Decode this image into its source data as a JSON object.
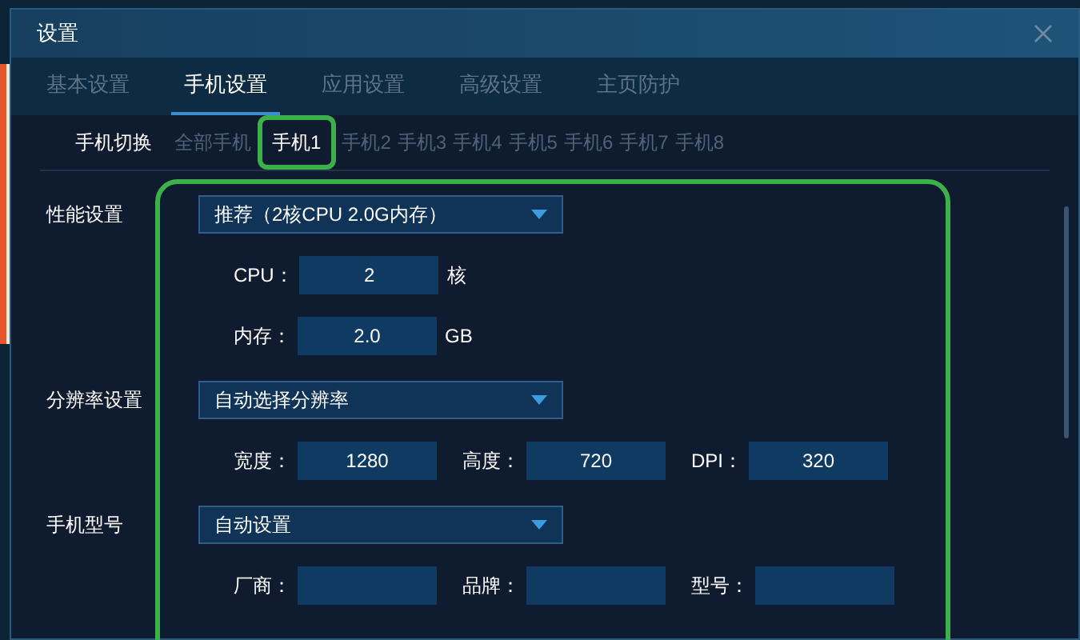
{
  "window": {
    "title": "设置"
  },
  "tabs": [
    {
      "label": "基本设置",
      "selected": false
    },
    {
      "label": "手机设置",
      "selected": true
    },
    {
      "label": "应用设置",
      "selected": false
    },
    {
      "label": "高级设置",
      "selected": false
    },
    {
      "label": "主页防护",
      "selected": false
    }
  ],
  "phone_switch": {
    "label": "手机切换",
    "items": [
      {
        "label": "全部手机",
        "selected": false
      },
      {
        "label": "手机1",
        "selected": true
      },
      {
        "label": "手机2",
        "selected": false
      },
      {
        "label": "手机3",
        "selected": false
      },
      {
        "label": "手机4",
        "selected": false
      },
      {
        "label": "手机5",
        "selected": false
      },
      {
        "label": "手机6",
        "selected": false
      },
      {
        "label": "手机7",
        "selected": false
      },
      {
        "label": "手机8",
        "selected": false
      }
    ]
  },
  "sections": [
    {
      "label": "性能设置",
      "dropdown": "推荐（2核CPU 2.0G内存）",
      "rows": [
        [
          {
            "label": "CPU：",
            "value": "2",
            "unit": "核"
          }
        ],
        [
          {
            "label": "内存：",
            "value": "2.0",
            "unit": "GB"
          }
        ]
      ]
    },
    {
      "label": "分辨率设置",
      "dropdown": "自动选择分辨率",
      "rows": [
        [
          {
            "label": "宽度：",
            "value": "1280"
          },
          {
            "label": "高度：",
            "value": "720"
          },
          {
            "label": "DPI：",
            "value": "320"
          }
        ]
      ]
    },
    {
      "label": "手机型号",
      "dropdown": "自动设置",
      "rows": [
        [
          {
            "label": "厂商："
          },
          {
            "label": "品牌："
          },
          {
            "label": "型号："
          }
        ]
      ]
    }
  ]
}
